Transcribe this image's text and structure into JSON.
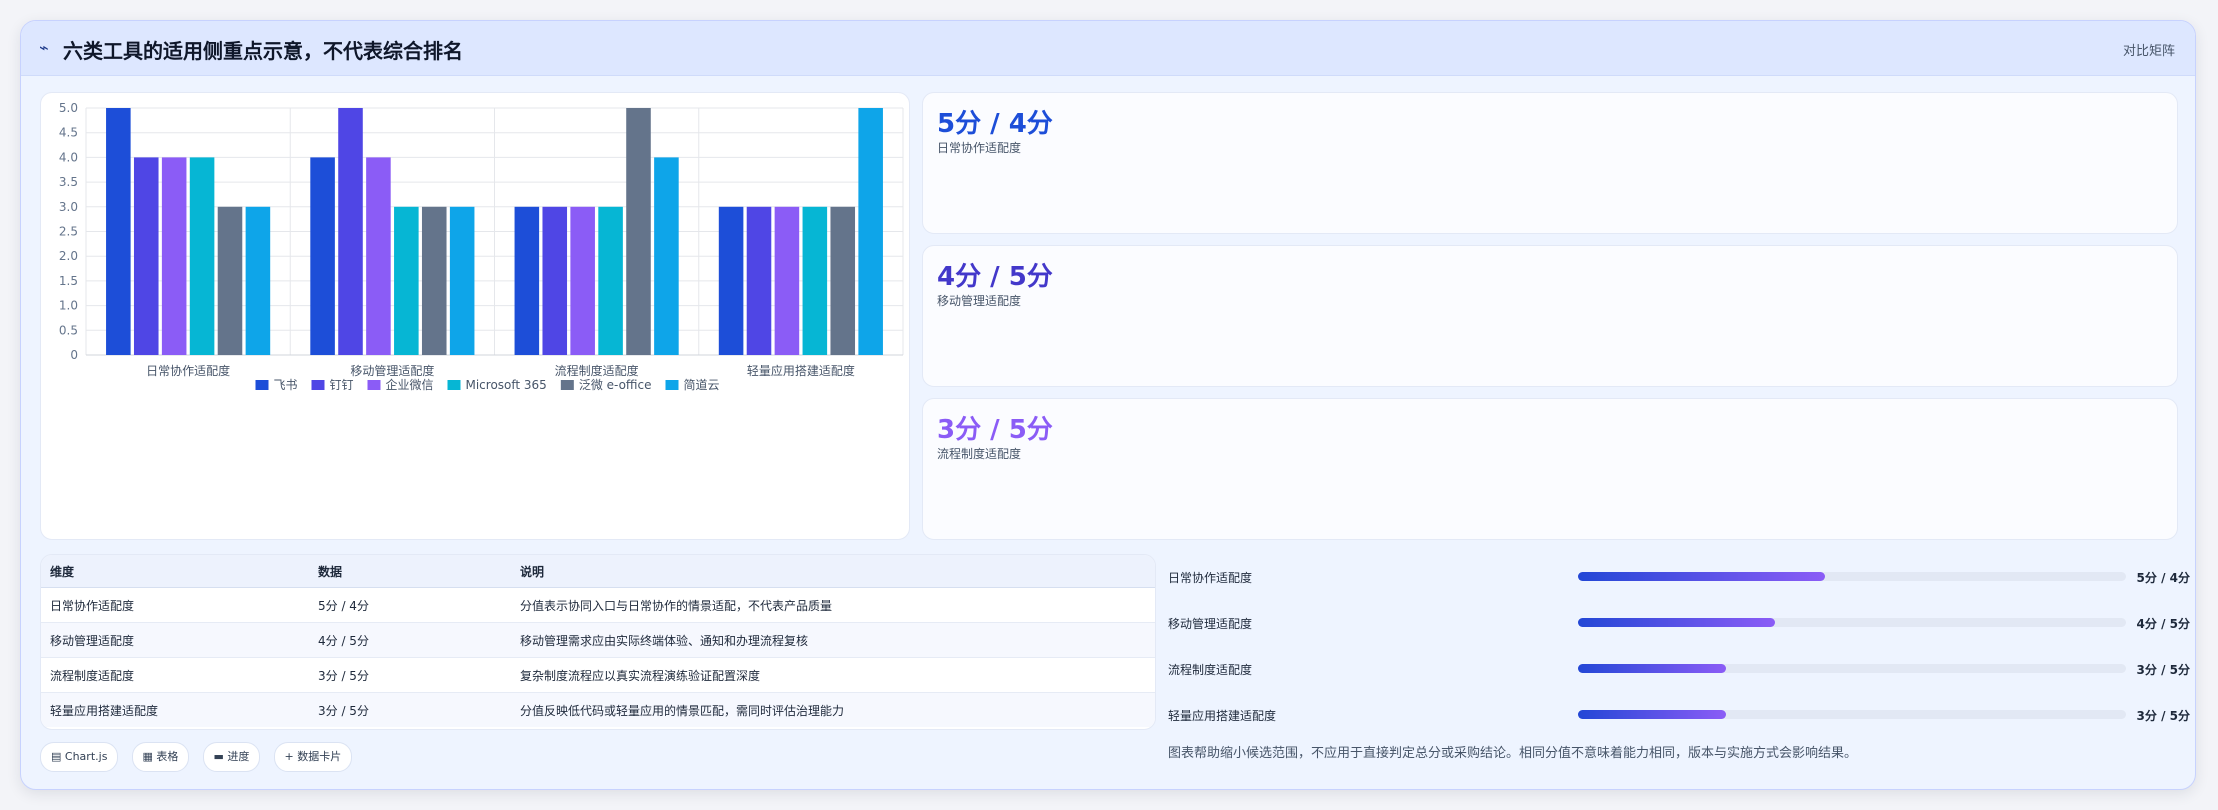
{
  "header": {
    "icon": "trend-line-icon",
    "title": "六类工具的适用侧重点示意，不代表综合排名",
    "right_label": "对比矩阵"
  },
  "chart_data": {
    "type": "bar",
    "categories": [
      "日常协作适配度",
      "移动管理适配度",
      "流程制度适配度",
      "轻量应用搭建适配度"
    ],
    "series": [
      {
        "name": "飞书",
        "color": "#1d4ed8",
        "values": [
          5,
          4,
          3,
          3
        ]
      },
      {
        "name": "钉钉",
        "color": "#4f46e5",
        "values": [
          4,
          5,
          3,
          3
        ]
      },
      {
        "name": "企业微信",
        "color": "#8b5cf6",
        "values": [
          4,
          4,
          3,
          3
        ]
      },
      {
        "name": "Microsoft 365",
        "color": "#06b6d4",
        "values": [
          4,
          3,
          3,
          3
        ]
      },
      {
        "name": "泛微 e-office",
        "color": "#64748b",
        "values": [
          3,
          3,
          5,
          3
        ]
      },
      {
        "name": "简道云",
        "color": "#0ea5e9",
        "values": [
          3,
          3,
          4,
          5
        ]
      }
    ],
    "ylim": [
      0,
      5
    ],
    "yticks": [
      "0",
      "0.5",
      "1.0",
      "1.5",
      "2.0",
      "2.5",
      "3.0",
      "3.5",
      "4.0",
      "4.5",
      "5.0"
    ],
    "grid": true,
    "legend": "bottom"
  },
  "stats": [
    {
      "value": "5分 / 4分",
      "label": "日常协作适配度",
      "color": "#1d4ed8"
    },
    {
      "value": "4分 / 5分",
      "label": "移动管理适配度",
      "color": "#4338ca"
    },
    {
      "value": "3分 / 5分",
      "label": "流程制度适配度",
      "color": "#8b5cf6"
    }
  ],
  "table": {
    "headers": [
      "维度",
      "数据",
      "说明"
    ],
    "rows": [
      [
        "日常协作适配度",
        "5分 / 4分",
        "分值表示协同入口与日常协作的情景适配，不代表产品质量"
      ],
      [
        "移动管理适配度",
        "4分 / 5分",
        "移动管理需求应由实际终端体验、通知和办理流程复核"
      ],
      [
        "流程制度适配度",
        "3分 / 5分",
        "复杂制度流程应以真实流程演练验证配置深度"
      ],
      [
        "轻量应用搭建适配度",
        "3分 / 5分",
        "分值反映低代码或轻量应用的情景匹配，需同时评估治理能力"
      ]
    ]
  },
  "chips": [
    {
      "icon": "chart-icon",
      "glyph": "▤",
      "label": "Chart.js"
    },
    {
      "icon": "table-icon",
      "glyph": "▦",
      "label": "表格"
    },
    {
      "icon": "progress-icon",
      "glyph": "▬",
      "label": "进度"
    },
    {
      "icon": "plus-icon",
      "glyph": "+",
      "label": "数据卡片"
    }
  ],
  "progress": [
    {
      "label": "日常协作适配度",
      "value": "5分 / 4分",
      "fraction": 0.45
    },
    {
      "label": "移动管理适配度",
      "value": "4分 / 5分",
      "fraction": 0.36
    },
    {
      "label": "流程制度适配度",
      "value": "3分 / 5分",
      "fraction": 0.27
    },
    {
      "label": "轻量应用搭建适配度",
      "value": "3分 / 5分",
      "fraction": 0.27
    }
  ],
  "note": "图表帮助缩小候选范围，不应用于直接判定总分或采购结论。相同分值不意味着能力相同，版本与实施方式会影响结果。"
}
